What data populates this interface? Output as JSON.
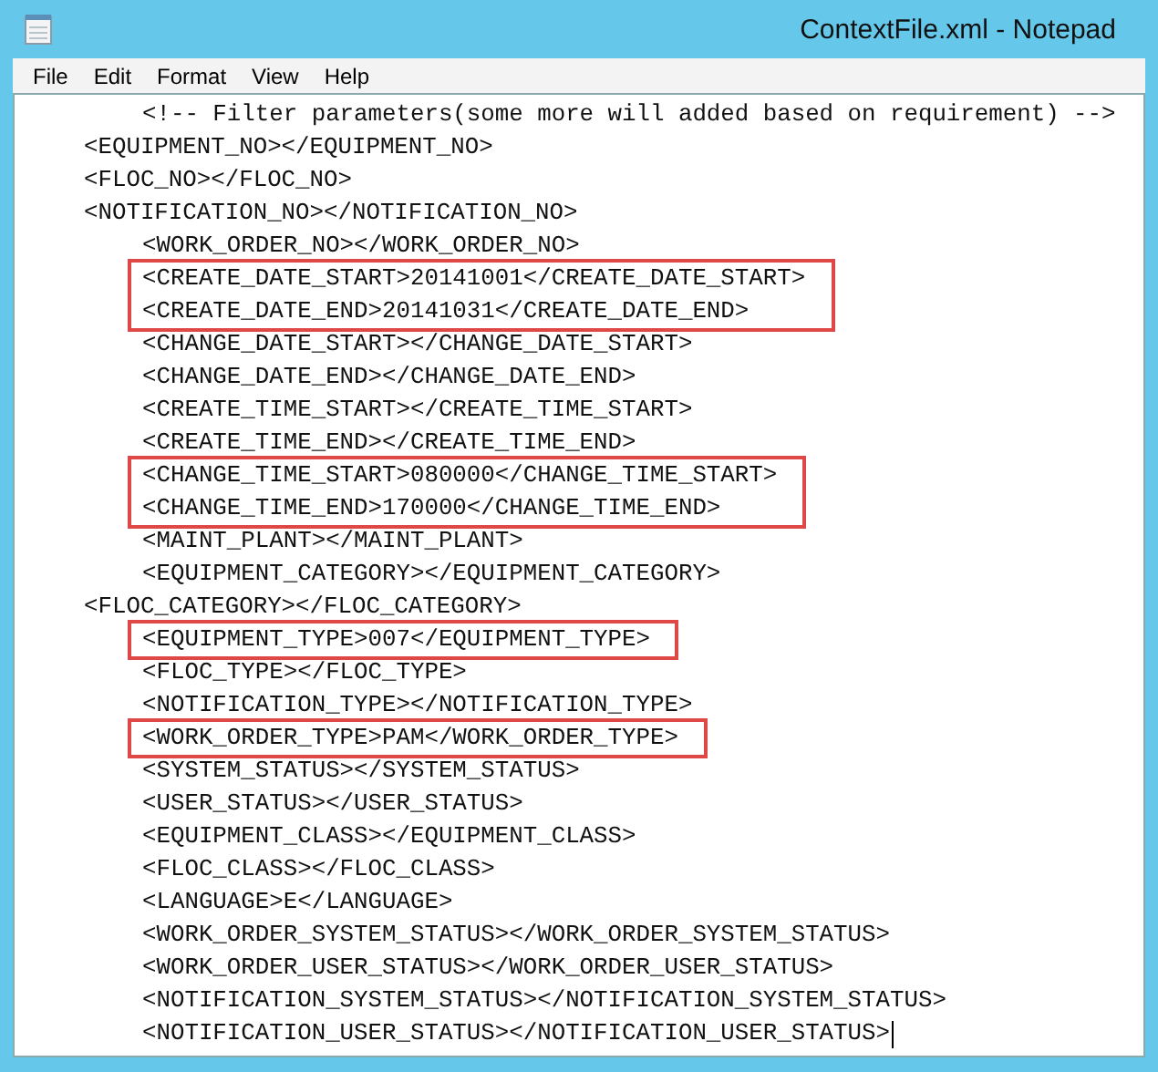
{
  "window": {
    "title": "ContextFile.xml - Notepad"
  },
  "menu": [
    "File",
    "Edit",
    "Format",
    "View",
    "Help"
  ],
  "editor": {
    "caret_at_end": true,
    "lines": [
      {
        "kind": "comment",
        "text": "<!-- Filter parameters(some more will added based on requirement) -->",
        "boxed": false
      },
      {
        "kind": "element",
        "text": "<EQUIPMENT_NO></EQUIPMENT_NO>",
        "boxed": false
      },
      {
        "kind": "element",
        "text": "<FLOC_NO></FLOC_NO>",
        "boxed": false
      },
      {
        "kind": "element",
        "text": "<NOTIFICATION_NO></NOTIFICATION_NO>",
        "boxed": false,
        "children": [
          {
            "kind": "element",
            "text": "<WORK_ORDER_NO></WORK_ORDER_NO>",
            "boxed": false
          },
          {
            "kind": "element",
            "text": "<CREATE_DATE_START>20141001</CREATE_DATE_START>",
            "boxed": true
          },
          {
            "kind": "element",
            "text": "<CREATE_DATE_END>20141031</CREATE_DATE_END>",
            "boxed": true
          },
          {
            "kind": "element",
            "text": "<CHANGE_DATE_START></CHANGE_DATE_START>",
            "boxed": false
          },
          {
            "kind": "element",
            "text": "<CHANGE_DATE_END></CHANGE_DATE_END>",
            "boxed": false
          },
          {
            "kind": "element",
            "text": "<CREATE_TIME_START></CREATE_TIME_START>",
            "boxed": false
          },
          {
            "kind": "element",
            "text": "<CREATE_TIME_END></CREATE_TIME_END>",
            "boxed": false
          },
          {
            "kind": "element",
            "text": "<CHANGE_TIME_START>080000</CHANGE_TIME_START>",
            "boxed": true
          },
          {
            "kind": "element",
            "text": "<CHANGE_TIME_END>170000</CHANGE_TIME_END>",
            "boxed": true
          },
          {
            "kind": "element",
            "text": "<MAINT_PLANT></MAINT_PLANT>",
            "boxed": false
          },
          {
            "kind": "element",
            "text": "<EQUIPMENT_CATEGORY></EQUIPMENT_CATEGORY>",
            "boxed": false
          }
        ]
      },
      {
        "kind": "element",
        "text": "<FLOC_CATEGORY></FLOC_CATEGORY>",
        "boxed": false,
        "children": [
          {
            "kind": "element",
            "text": "<EQUIPMENT_TYPE>007</EQUIPMENT_TYPE>",
            "boxed": true
          },
          {
            "kind": "element",
            "text": "<FLOC_TYPE></FLOC_TYPE>",
            "boxed": false
          },
          {
            "kind": "element",
            "text": "<NOTIFICATION_TYPE></NOTIFICATION_TYPE>",
            "boxed": false
          },
          {
            "kind": "element",
            "text": "<WORK_ORDER_TYPE>PAM</WORK_ORDER_TYPE>",
            "boxed": true
          },
          {
            "kind": "element",
            "text": "<SYSTEM_STATUS></SYSTEM_STATUS>",
            "boxed": false
          },
          {
            "kind": "element",
            "text": "<USER_STATUS></USER_STATUS>",
            "boxed": false
          },
          {
            "kind": "element",
            "text": "<EQUIPMENT_CLASS></EQUIPMENT_CLASS>",
            "boxed": false
          },
          {
            "kind": "element",
            "text": "<FLOC_CLASS></FLOC_CLASS>",
            "boxed": false
          },
          {
            "kind": "element",
            "text": "<LANGUAGE>E</LANGUAGE>",
            "boxed": false
          },
          {
            "kind": "element",
            "text": "<WORK_ORDER_SYSTEM_STATUS></WORK_ORDER_SYSTEM_STATUS>",
            "boxed": false
          },
          {
            "kind": "element",
            "text": "<WORK_ORDER_USER_STATUS></WORK_ORDER_USER_STATUS>",
            "boxed": false
          },
          {
            "kind": "element",
            "text": "<NOTIFICATION_SYSTEM_STATUS></NOTIFICATION_SYSTEM_STATUS>",
            "boxed": false
          },
          {
            "kind": "element",
            "text": "<NOTIFICATION_USER_STATUS></NOTIFICATION_USER_STATUS>",
            "boxed": false
          }
        ]
      }
    ]
  }
}
